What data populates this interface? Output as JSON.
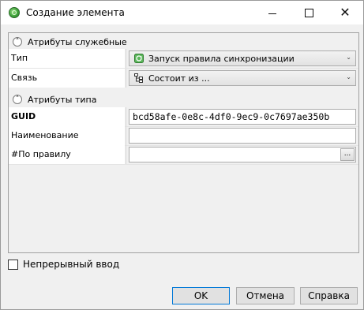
{
  "window": {
    "title": "Создание элемента"
  },
  "grid": {
    "sections": [
      {
        "label": "Атрибуты служебные",
        "rows": [
          {
            "name": "Тип",
            "value": "Запуск правила синхронизации"
          },
          {
            "name": "Связь",
            "value": "Состоит из ..."
          }
        ]
      },
      {
        "label": "Атрибуты типа",
        "rows": [
          {
            "name": "GUID",
            "value": "bcd58afe-0e8c-4df0-9ec9-0c7697ae350b"
          },
          {
            "name": "Наименование",
            "value": ""
          },
          {
            "name": "#По правилу",
            "value": "",
            "button": "..."
          }
        ]
      }
    ]
  },
  "continuous_input": {
    "label": "Непрерывный ввод",
    "checked": false
  },
  "buttons": {
    "ok": "OK",
    "cancel": "Отмена",
    "help": "Справка"
  },
  "colors": {
    "accent": "#0078d7",
    "icon_green": "#3fa33a"
  }
}
